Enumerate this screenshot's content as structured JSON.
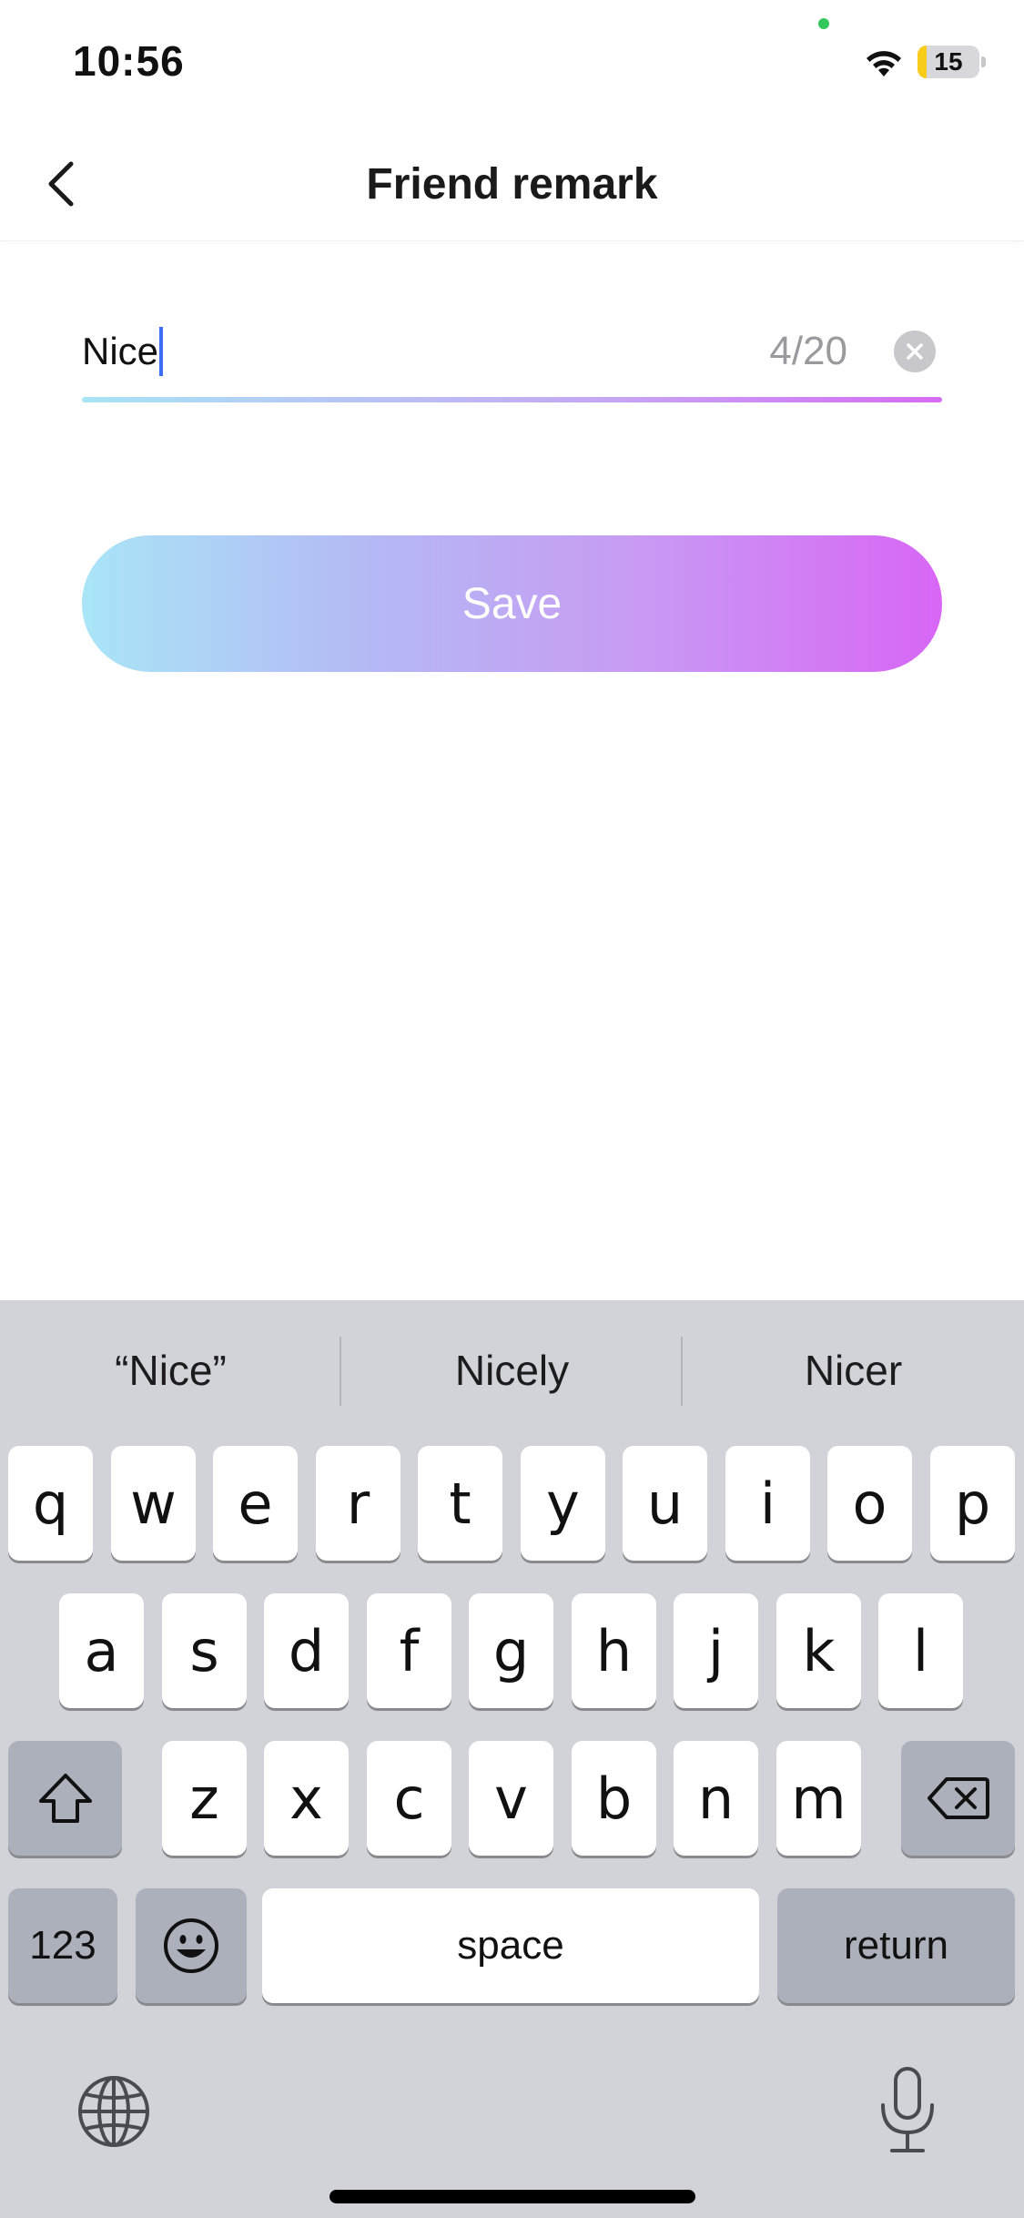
{
  "status_bar": {
    "time": "10:56",
    "battery": "15",
    "battery_fraction": 0.15
  },
  "nav": {
    "title": "Friend remark",
    "back_icon": "chevron-left-icon"
  },
  "remark_field": {
    "value": "Nice",
    "counter": "4/20",
    "clear_icon": "clear-x-icon"
  },
  "save_button": {
    "label": "Save"
  },
  "colors": {
    "gradient_start": "#a9e5f7",
    "gradient_mid": "#c89af3",
    "gradient_end": "#d866f5",
    "caret": "#3b6ef5",
    "keyboard_bg": "#d1d3d9"
  },
  "keyboard": {
    "suggestions": [
      "“Nice”",
      "Nicely",
      "Nicer"
    ],
    "row1": [
      "q",
      "w",
      "e",
      "r",
      "t",
      "y",
      "u",
      "i",
      "o",
      "p"
    ],
    "row2": [
      "a",
      "s",
      "d",
      "f",
      "g",
      "h",
      "j",
      "k",
      "l"
    ],
    "row3": [
      "z",
      "x",
      "c",
      "v",
      "b",
      "n",
      "m"
    ],
    "numbers_key": "123",
    "space_key": "space",
    "return_key": "return",
    "icons": {
      "shift": "shift-icon",
      "delete": "backspace-icon",
      "emoji": "emoji-icon",
      "globe": "globe-icon",
      "mic": "microphone-icon"
    }
  }
}
